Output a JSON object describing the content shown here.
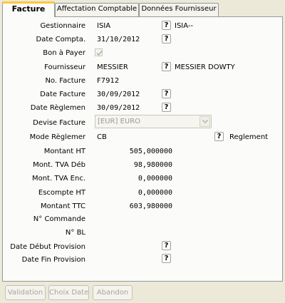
{
  "tabs": [
    {
      "label": "Facture",
      "active": true
    },
    {
      "label": "Affectation Comptable",
      "active": false
    },
    {
      "label": "Données Fournisseur",
      "active": false
    }
  ],
  "form": {
    "gestionnaire": {
      "label": "Gestionnaire",
      "value": "ISIA",
      "help": "?",
      "extra": "ISIA--"
    },
    "date_compta": {
      "label": "Date Compta.",
      "value": "31/10/2012",
      "help": "?"
    },
    "bon_a_payer": {
      "label": "Bon à Payer",
      "checked": true
    },
    "fournisseur": {
      "label": "Fournisseur",
      "value": "MESSIER",
      "help": "?",
      "extra": "MESSIER DOWTY"
    },
    "no_facture": {
      "label": "No. Facture",
      "value": "F7912"
    },
    "date_facture": {
      "label": "Date Facture",
      "value": "30/09/2012",
      "help": "?"
    },
    "date_reglement": {
      "label": "Date Règlemen",
      "value": "30/09/2012",
      "help": "?"
    },
    "devise_facture": {
      "label": "Devise Facture",
      "value": "[EUR] EURO"
    },
    "mode_reglement": {
      "label": "Mode Règlemer",
      "value": "CB",
      "help": "?",
      "extra": "Reglement"
    },
    "montant_ht": {
      "label": "Montant HT",
      "value": "505,000000"
    },
    "mont_tva_deb": {
      "label": "Mont. TVA Déb",
      "value": "98,980000"
    },
    "mont_tva_enc": {
      "label": "Mont. TVA Enc.",
      "value": "0,000000"
    },
    "escompte_ht": {
      "label": "Escompte HT",
      "value": "0,000000"
    },
    "montant_ttc": {
      "label": "Montant TTC",
      "value": "603,980000"
    },
    "no_commande": {
      "label": "N° Commande",
      "value": ""
    },
    "no_bl": {
      "label": "N° BL",
      "value": ""
    },
    "date_debut_provision": {
      "label": "Date Début Provision",
      "help": "?"
    },
    "date_fin_provision": {
      "label": "Date Fin Provision",
      "help": "?"
    }
  },
  "buttons": {
    "validation": "Validation",
    "choix_date": "Choix Date",
    "abandon": "Abandon"
  }
}
